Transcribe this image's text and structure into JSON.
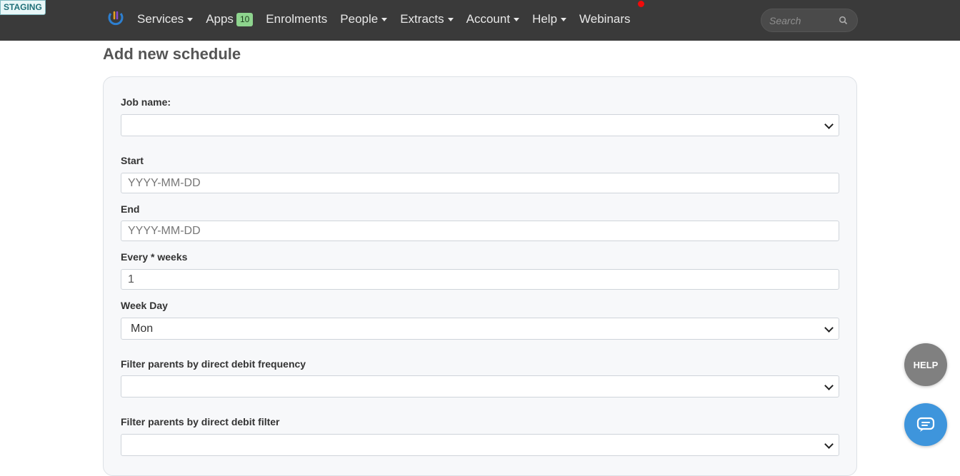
{
  "env_badge": "STAGING",
  "nav": {
    "logo_icon": "brand-logo-icon",
    "items": [
      {
        "label": "Services",
        "dropdown": true
      },
      {
        "label": "Apps",
        "badge": "10"
      },
      {
        "label": "Enrolments"
      },
      {
        "label": "People",
        "dropdown": true
      },
      {
        "label": "Extracts",
        "dropdown": true
      },
      {
        "label": "Account",
        "dropdown": true
      },
      {
        "label": "Help",
        "dropdown": true
      },
      {
        "label": "Webinars",
        "notification_dot": true
      }
    ],
    "search_placeholder": "Search",
    "search_icon": "search-icon"
  },
  "page": {
    "title": "Add new schedule"
  },
  "form": {
    "job_name": {
      "label": "Job name:",
      "value": ""
    },
    "start": {
      "label": "Start",
      "placeholder": "YYYY-MM-DD"
    },
    "end": {
      "label": "End",
      "placeholder": "YYYY-MM-DD"
    },
    "every_weeks": {
      "label": "Every * weeks",
      "value": "1"
    },
    "week_day": {
      "label": "Week Day",
      "value": "Mon"
    },
    "dd_frequency": {
      "label": "Filter parents by direct debit frequency",
      "value": ""
    },
    "dd_filter": {
      "label": "Filter parents by direct debit filter",
      "value": ""
    }
  },
  "floating": {
    "help_label": "HELP",
    "chat_icon": "chat-icon"
  },
  "colors": {
    "topbar": "#3a3a3a",
    "badge": "#8ed48e",
    "notification": "#f00a0a",
    "help_button": "#808080",
    "chat_button": "#3e95dc"
  }
}
